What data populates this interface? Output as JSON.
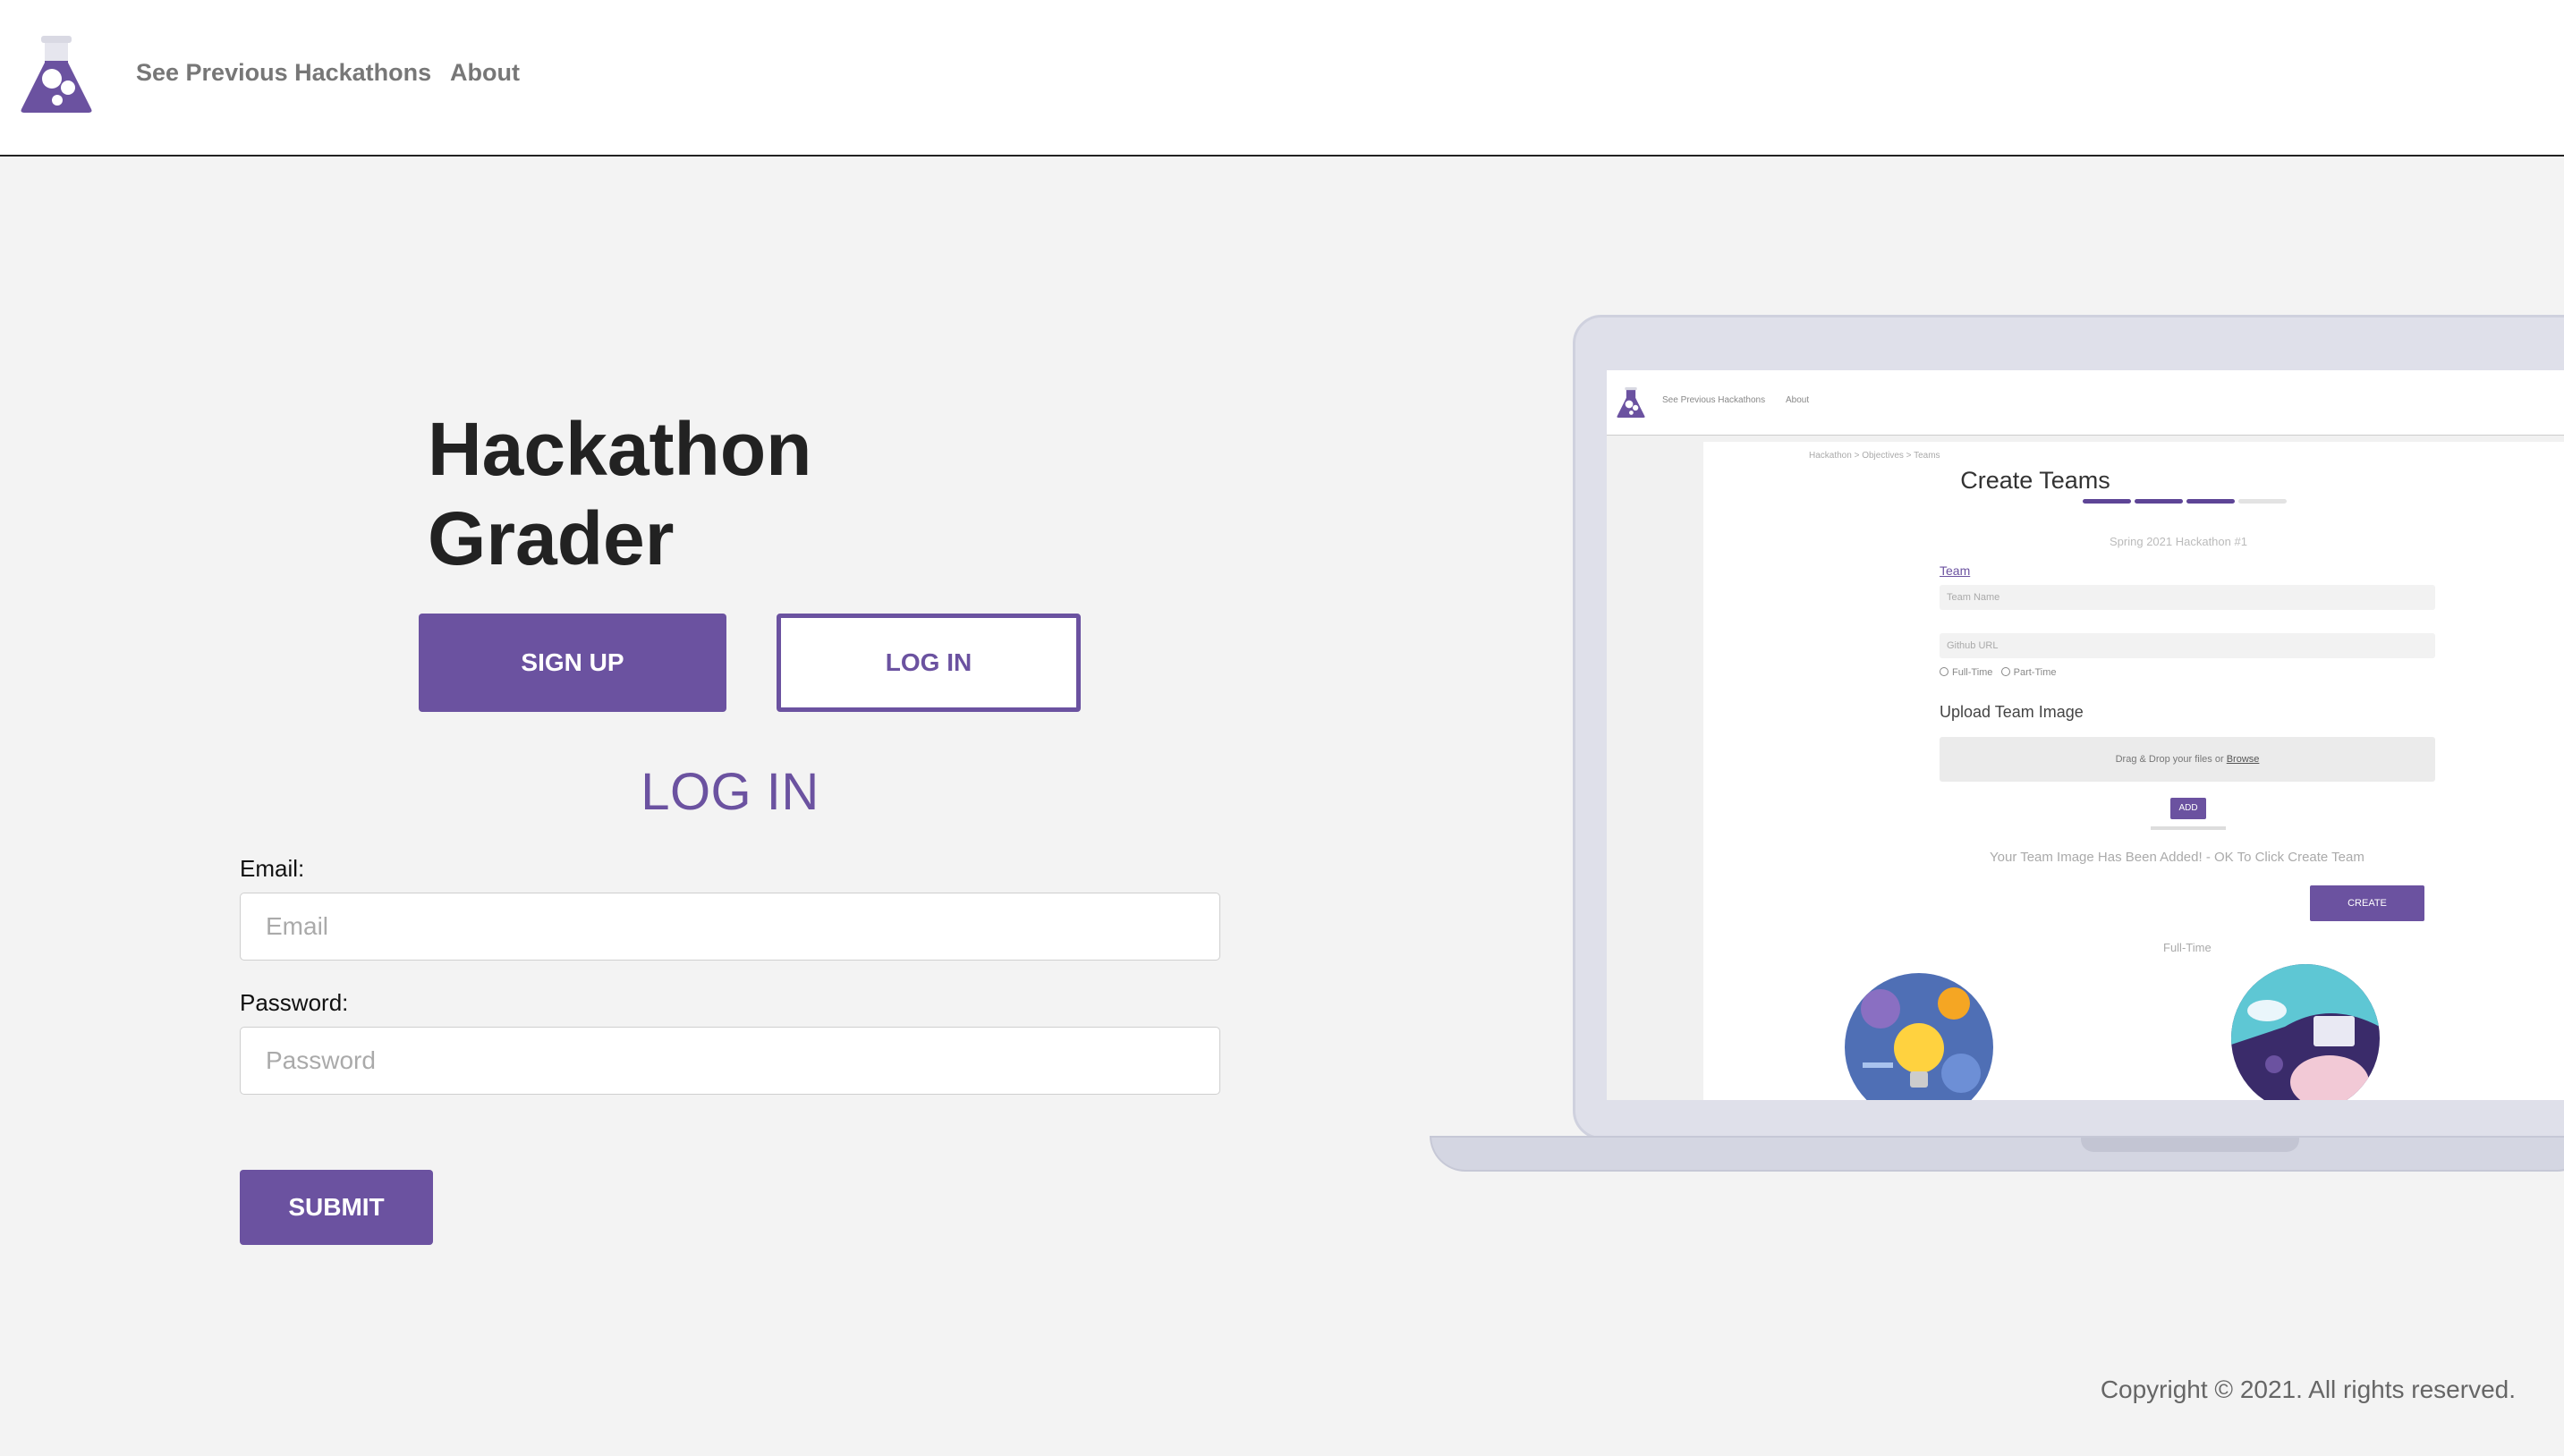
{
  "nav": {
    "previous_hackathons": "See Previous Hackathons",
    "about": "About"
  },
  "hero": {
    "title_line1": "Hackathon",
    "title_line2": "Grader",
    "signup_button": "SIGN UP",
    "login_button": "LOG IN"
  },
  "form": {
    "heading": "LOG IN",
    "email_label": "Email:",
    "email_placeholder": "Email",
    "email_value": "",
    "password_label": "Password:",
    "password_placeholder": "Password",
    "password_value": "",
    "submit_button": "SUBMIT"
  },
  "footer": {
    "copyright": "Copyright © 2021. All rights reserved."
  },
  "preview": {
    "nav_previous": "See Previous Hackathons",
    "nav_about": "About",
    "breadcrumb": "Hackathon > Objectives > Teams",
    "title": "Create Teams",
    "step_total": 4,
    "steps_completed": 3,
    "subtitle": "Spring 2021 Hackathon #1",
    "team_link": "Team",
    "team_name_placeholder": "Team Name",
    "github_placeholder": "Github URL",
    "radio_fulltime": "Full-Time",
    "radio_parttime": "Part-Time",
    "upload_label": "Upload Team Image",
    "dropzone_text": "Drag & Drop your files or",
    "dropzone_browse": "Browse",
    "add_button": "ADD",
    "success_message": "Your Team Image Has Been Added! - OK To Click Create Team",
    "create_button": "CREATE",
    "section_label": "Full-Time"
  },
  "colors": {
    "brand": "#6b52a0",
    "background": "#f3f3f3",
    "header_bg": "#ffffff",
    "laptop_frame": "#dfe0ea"
  },
  "icons": {
    "logo": "flask-logo-icon"
  }
}
